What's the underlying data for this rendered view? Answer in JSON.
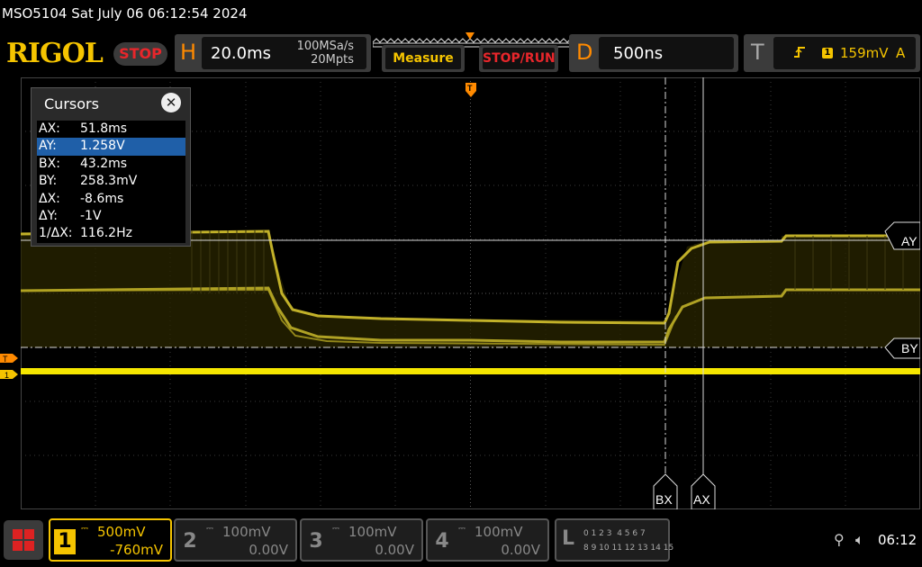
{
  "title_bar": {
    "text": "MSO5104  Sat July 06 06:12:54 2024"
  },
  "header": {
    "logo": "RIGOL",
    "run_state": "STOP",
    "horizontal": {
      "letter": "H",
      "timebase": "20.0ms",
      "sample_rate": "100MSa/s",
      "memory_depth": "20Mpts"
    },
    "measure_label": "Measure",
    "stop_run_label": "STOP/RUN",
    "delay": {
      "letter": "D",
      "value": "500ns"
    },
    "trigger": {
      "letter": "T",
      "source": "1",
      "level": "159mV",
      "mode": "A"
    }
  },
  "cursors_panel": {
    "title": "Cursors",
    "rows": [
      {
        "key": "AX:",
        "value": "51.8ms"
      },
      {
        "key": "AY:",
        "value": "1.258V"
      },
      {
        "key": "BX:",
        "value": "43.2ms"
      },
      {
        "key": "BY:",
        "value": "258.3mV"
      },
      {
        "key": "ΔX:",
        "value": "-8.6ms"
      },
      {
        "key": "ΔY:",
        "value": "-1V"
      },
      {
        "key": "1/ΔX:",
        "value": "116.2Hz"
      }
    ],
    "selected_row": 1
  },
  "cursor_labels": {
    "ay": "AY",
    "by": "BY",
    "bx": "BX",
    "ax": "AX"
  },
  "edge_markers": {
    "trigger": "T",
    "channel": "1"
  },
  "channels": [
    {
      "number": "1",
      "scale": "500mV",
      "offset": "-760mV",
      "active": true
    },
    {
      "number": "2",
      "scale": "100mV",
      "offset": "0.00V",
      "active": false
    },
    {
      "number": "3",
      "scale": "100mV",
      "offset": "0.00V",
      "active": false
    },
    {
      "number": "4",
      "scale": "100mV",
      "offset": "0.00V",
      "active": false
    }
  ],
  "logic": {
    "letter": "L",
    "row1": "0 1 2 3  4 5 6 7",
    "row2": "8 9 10 11 12 13 14 15"
  },
  "status": {
    "clock": "06:12"
  },
  "colors": {
    "ch1": "#f5c400",
    "accent": "#ff8a00",
    "stop": "#e8262b",
    "selected": "#1f5fa8"
  }
}
